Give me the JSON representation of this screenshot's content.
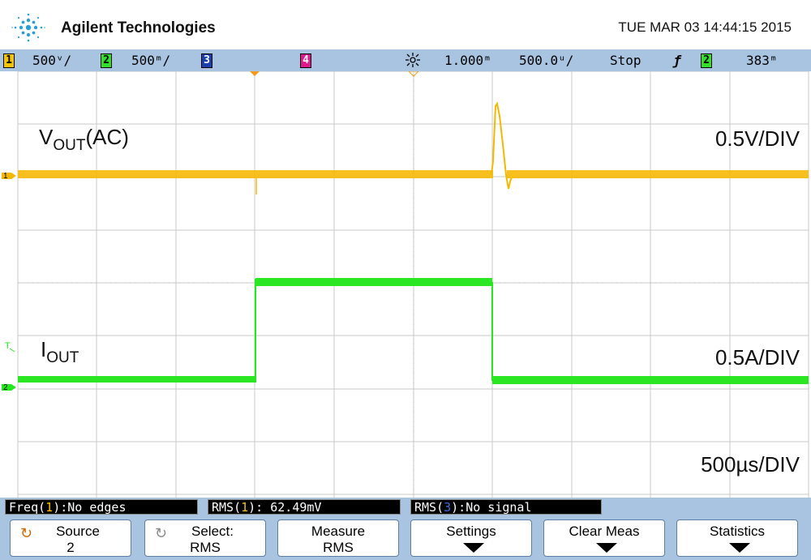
{
  "header": {
    "brand": "Agilent Technologies",
    "datetime": "TUE MAR 03 14:44:15 2015"
  },
  "statusbar": {
    "ch1_num": "1",
    "ch1_scale": "500ᵛ/",
    "ch2_num": "2",
    "ch2_scale": "500ᵐ/",
    "ch3_num": "3",
    "ch4_num": "4",
    "time_position": "1.000ᵐ",
    "time_scale": "500.0ᵘ/",
    "run_state": "Stop",
    "trigger_symbol": "ƒ",
    "trigger_source": "2",
    "trigger_level": "383ᵐ"
  },
  "screen": {
    "vout_label_main": "V",
    "vout_label_sub": "OUT",
    "vout_label_tail": "(AC)",
    "iout_label_main": "I",
    "iout_label_sub": "OUT",
    "vout_scale": "0.5V/DIV",
    "iout_scale": "0.5A/DIV",
    "time_scale": "500µs/DIV",
    "ch1_marker": "1",
    "ch2_marker": "2",
    "trigger_marker": "T",
    "colors": {
      "ch1": "#f5b800",
      "ch2": "#22e81c",
      "grid": "#c8c8c8"
    }
  },
  "measurements": {
    "freq_prefix": "Freq(",
    "freq_ch": "1",
    "freq_suffix": "):No edges",
    "rms1_prefix": "RMS(",
    "rms1_ch": "1",
    "rms1_suffix": "): 62.49mV",
    "rms3_prefix": "RMS(",
    "rms3_ch": "3",
    "rms3_suffix": "):No signal"
  },
  "softkeys": {
    "source_l1": "Source",
    "source_l2": "2",
    "select_l1": "Select:",
    "select_l2": "RMS",
    "measure_l1": "Measure",
    "measure_l2": "RMS",
    "settings_l1": "Settings",
    "clear_l1": "Clear Meas",
    "statistics_l1": "Statistics",
    "source_icon": "rotate-knob-icon",
    "select_icon": "rotate-knob-icon",
    "submenu_icon": "arrow-down-icon"
  }
}
